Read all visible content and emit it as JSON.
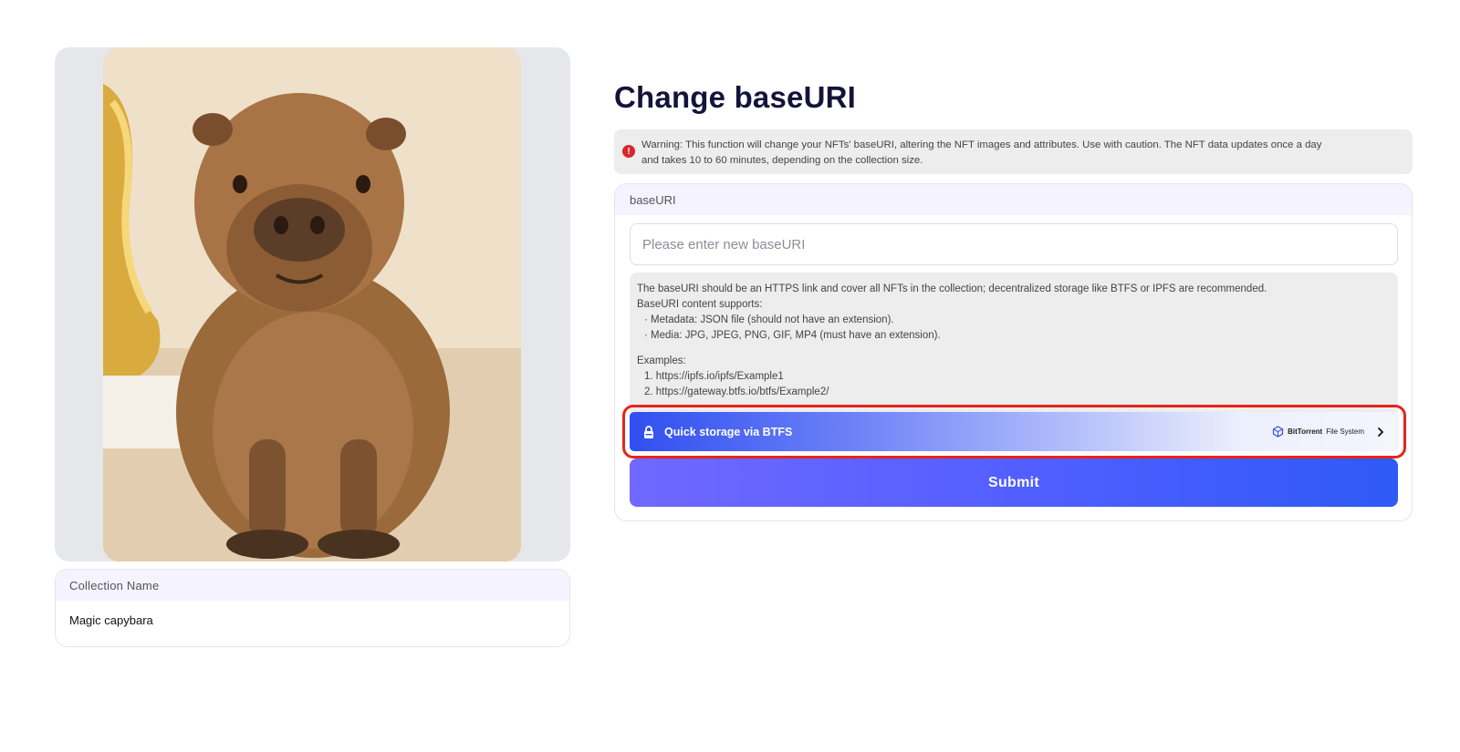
{
  "collection": {
    "header": "Collection Name",
    "name": "Magic capybara"
  },
  "page": {
    "title": "Change baseURI"
  },
  "warning": {
    "icon": "warning-icon",
    "line1": "Warning: This function will change your NFTs' baseURI, altering the NFT images and attributes. Use with caution. The NFT data updates once a day",
    "line2": "and takes 10 to 60 minutes, depending on the collection size."
  },
  "form": {
    "header": "baseURI",
    "input_placeholder": "Please enter new baseURI",
    "input_value": "",
    "help": {
      "intro": "The baseURI should be an HTTPS link and cover all NFTs in the collection; decentralized storage like BTFS or IPFS are recommended.",
      "supports": "BaseURI content supports:",
      "bullet_metadata": "· Metadata: JSON file (should not have an extension).",
      "bullet_media": "· Media: JPG, JPEG, PNG, GIF, MP4 (must have an extension).",
      "examples_label": "Examples:",
      "example1": "1. https://ipfs.io/ipfs/Example1",
      "example2": "2. https://gateway.btfs.io/btfs/Example2/"
    },
    "btfs": {
      "label": "Quick storage via BTFS",
      "brand_bold": "BitTorrent",
      "brand_rest": "File System",
      "highlight_color": "#e8241a"
    },
    "submit_label": "Submit"
  },
  "colors": {
    "title": "#14143a",
    "warning_icon": "#d9262b",
    "primary_blue": "#2f4ff0",
    "submit_start": "#7068ff",
    "submit_end": "#2e5af5"
  }
}
